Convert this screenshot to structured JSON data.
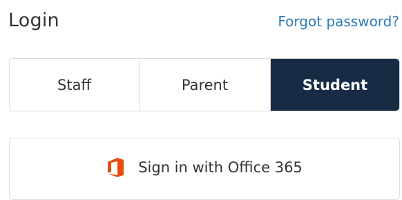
{
  "header": {
    "title": "Login",
    "forgot_password": "Forgot password?"
  },
  "role_tabs": {
    "items": [
      {
        "label": "Staff",
        "active": false
      },
      {
        "label": "Parent",
        "active": false
      },
      {
        "label": "Student",
        "active": true
      }
    ]
  },
  "sso": {
    "office365_label": "Sign in with Office 365",
    "icon": "office-365-icon"
  },
  "colors": {
    "accent": "#172b44",
    "link": "#2a7ab8",
    "office_orange": "#e84c0e"
  }
}
